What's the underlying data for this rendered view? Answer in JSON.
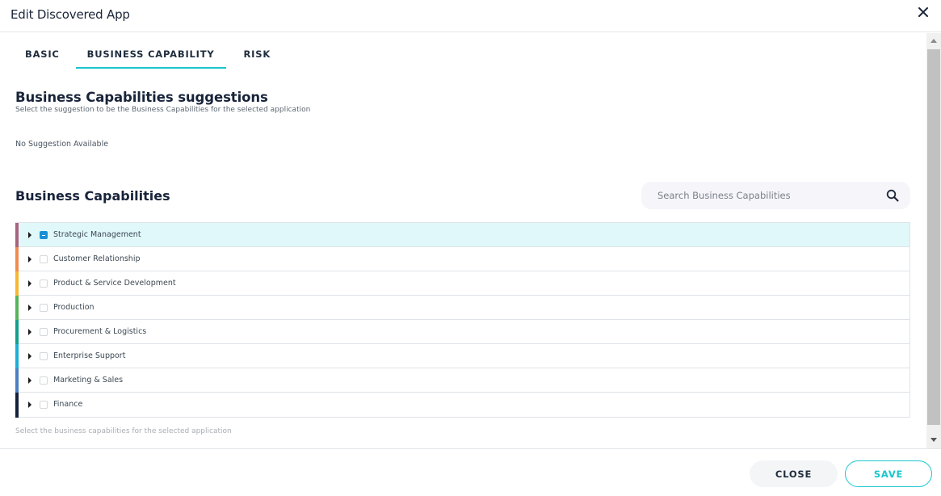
{
  "dialog": {
    "title": "Edit Discovered App",
    "close_icon": "close-icon"
  },
  "tabs": [
    {
      "label": "BASIC",
      "active": false
    },
    {
      "label": "BUSINESS CAPABILITY",
      "active": true
    },
    {
      "label": "RISK",
      "active": false
    }
  ],
  "suggestions": {
    "title": "Business Capabilities suggestions",
    "subtitle": "Select the suggestion to be the Business Capabilities for the selected application",
    "empty_text": "No Suggestion Available"
  },
  "capabilities": {
    "title": "Business Capabilities",
    "search_placeholder": "Search Business Capabilities",
    "search_value": "",
    "helper_text": "Select the business capabilities for the selected application",
    "items": [
      {
        "label": "Strategic Management",
        "color": "#a8637e",
        "state": "indeterminate",
        "selected": true
      },
      {
        "label": "Customer Relationship",
        "color": "#ef8c50",
        "state": "unchecked",
        "selected": false
      },
      {
        "label": "Product & Service Development",
        "color": "#f7b731",
        "state": "unchecked",
        "selected": false
      },
      {
        "label": "Production",
        "color": "#56b45a",
        "state": "unchecked",
        "selected": false
      },
      {
        "label": "Procurement & Logistics",
        "color": "#13a08c",
        "state": "unchecked",
        "selected": false
      },
      {
        "label": "Enterprise Support",
        "color": "#1eaed6",
        "state": "unchecked",
        "selected": false
      },
      {
        "label": "Marketing & Sales",
        "color": "#4a7fc1",
        "state": "unchecked",
        "selected": false
      },
      {
        "label": "Finance",
        "color": "#16213a",
        "state": "unchecked",
        "selected": false
      }
    ]
  },
  "footer": {
    "close_label": "CLOSE",
    "save_label": "SAVE"
  },
  "colors": {
    "accent": "#19c6cf",
    "checkbox_active": "#1a8fd6",
    "selected_row_bg": "#e0f8fa"
  }
}
